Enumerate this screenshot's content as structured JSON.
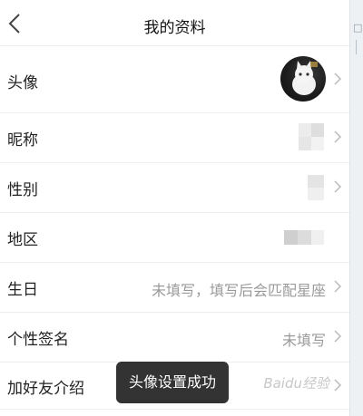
{
  "header": {
    "title": "我的资料"
  },
  "rows": [
    {
      "label": "头像"
    },
    {
      "label": "昵称"
    },
    {
      "label": "性别"
    },
    {
      "label": "地区"
    },
    {
      "label": "生日",
      "value": "未填写，填写后会匹配星座"
    },
    {
      "label": "个性签名",
      "value": "未填写"
    },
    {
      "label": "加好友介绍"
    }
  ],
  "toast": {
    "text": "头像设置成功"
  },
  "watermark": {
    "text": "Baidu经验"
  }
}
